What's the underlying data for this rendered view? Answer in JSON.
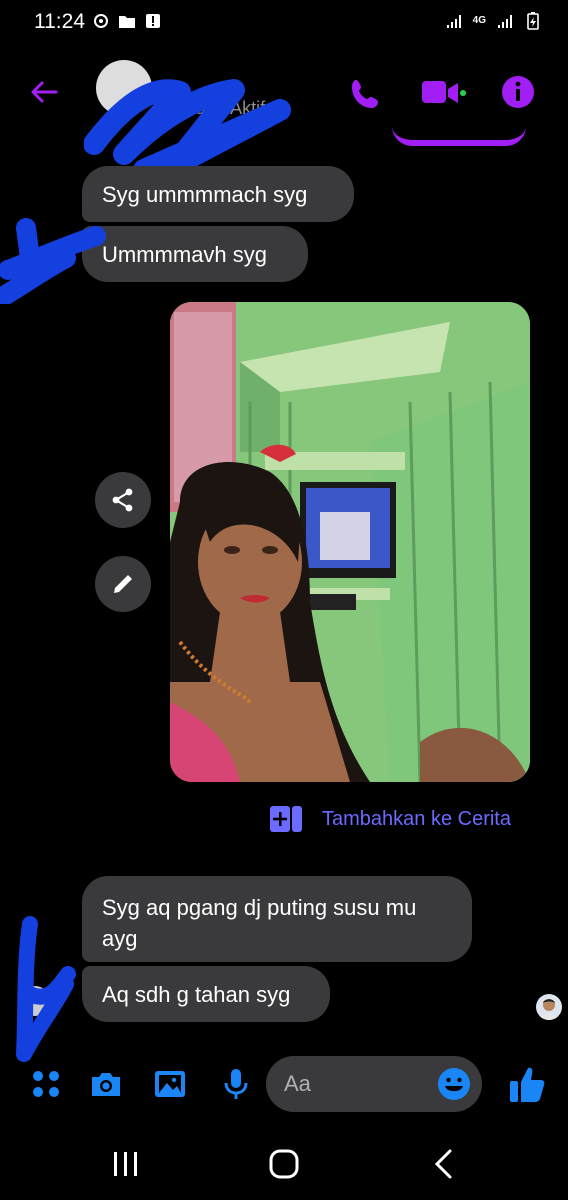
{
  "status_bar": {
    "time": "11:24",
    "network": "4G"
  },
  "header": {
    "contact_name": "",
    "contact_status": "Sedang Aktif",
    "accent_color": "#a11ef5",
    "active_dot_color": "#2bd04f"
  },
  "messages": [
    {
      "text": "Syg ummmmach syg",
      "direction": "incoming"
    },
    {
      "text": "Ummmmavh syg",
      "direction": "incoming"
    },
    {
      "type": "photo",
      "direction": "outgoing"
    },
    {
      "text": "Syg aq pgang dj puting susu mu ayg",
      "direction": "incoming"
    },
    {
      "text": "Aq sdh g tahan syg",
      "direction": "incoming"
    }
  ],
  "photo_actions": {
    "add_to_story_label": "Tambahkan ke Cerita"
  },
  "composer": {
    "placeholder": "Aa",
    "accent_color": "#1a86f5"
  },
  "icons": {
    "header": [
      "back-arrow-icon",
      "phone-icon",
      "video-camera-icon",
      "info-icon"
    ],
    "composer": [
      "menu-dots-icon",
      "camera-icon",
      "gallery-icon",
      "microphone-icon",
      "emoji-icon",
      "thumbs-up-icon"
    ],
    "navbar": [
      "recent-apps-icon",
      "home-icon",
      "back-icon"
    ]
  }
}
